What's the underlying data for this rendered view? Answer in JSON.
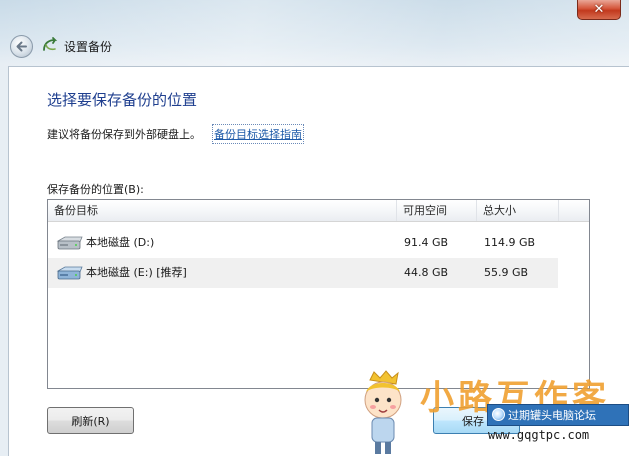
{
  "window": {
    "title": "设置备份",
    "close_symbol": "✕"
  },
  "main": {
    "heading": "选择要保存备份的位置",
    "hint_text": "建议将备份保存到外部硬盘上。",
    "hint_link": "备份目标选择指南",
    "list_label": "保存备份的位置(B):"
  },
  "table": {
    "columns": [
      "备份目标",
      "可用空间",
      "总大小"
    ],
    "rows": [
      {
        "name": "本地磁盘 (D:)",
        "free": "91.4 GB",
        "total": "114.9 GB",
        "selected": false
      },
      {
        "name": "本地磁盘 (E:) [推荐]",
        "free": "44.8 GB",
        "total": "55.9 GB",
        "selected": true
      }
    ]
  },
  "buttons": {
    "refresh": "刷新(R)",
    "save": "保存"
  },
  "watermark": {
    "title": "小路互作客",
    "badge": "过期罐头电脑论坛",
    "url": "www.gqgtpc.com"
  },
  "colors": {
    "heading": "#1f3f8f",
    "link": "#1e5aa8",
    "close": "#c2391d"
  },
  "icons": {
    "back": "back-arrow-icon",
    "app": "backup-app-icon",
    "drive": "hard-drive-icon"
  }
}
